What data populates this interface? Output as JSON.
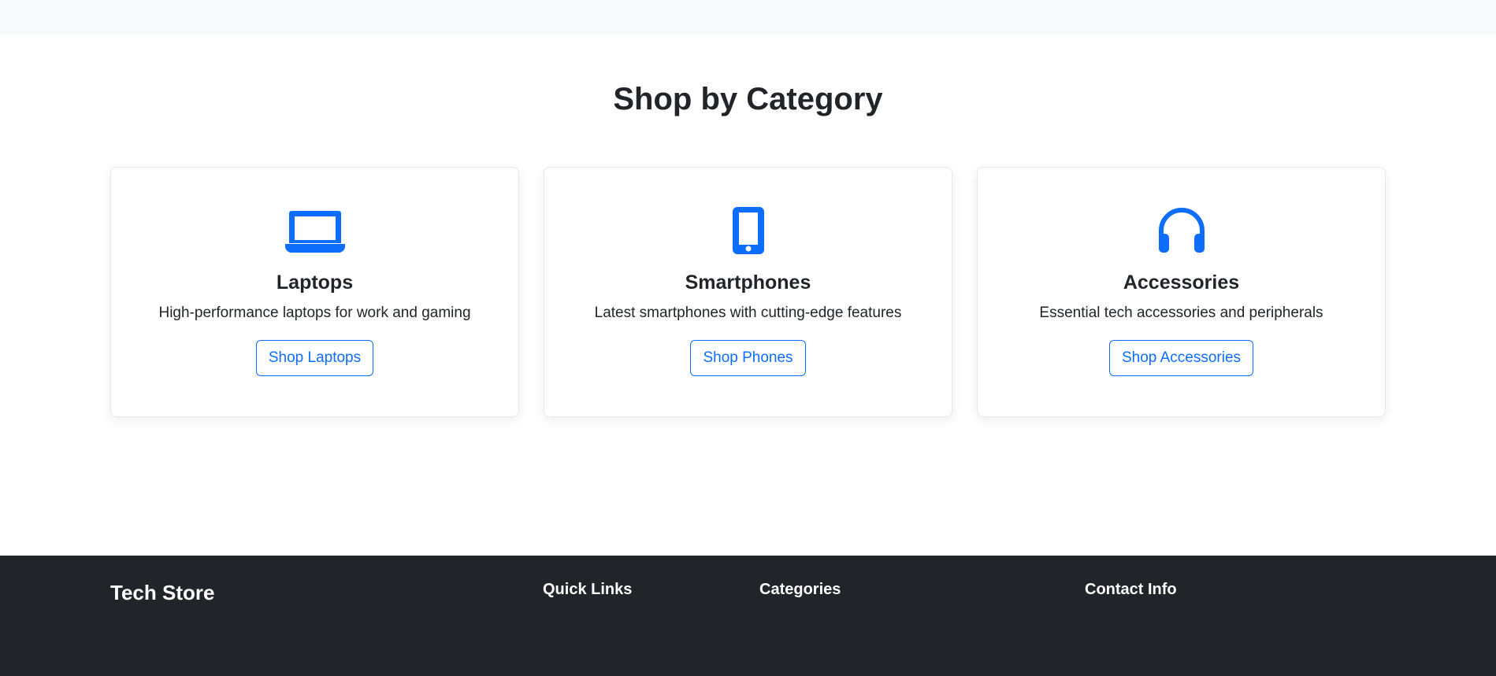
{
  "section": {
    "title": "Shop by Category"
  },
  "colors": {
    "accent": "#0d6efd",
    "footer_bg": "#212529",
    "top_band": "#f8f9fa"
  },
  "categories": [
    {
      "icon": "laptop-icon",
      "name": "Laptops",
      "description": "High-performance laptops for work and gaming",
      "button": "Shop Laptops"
    },
    {
      "icon": "phone-icon",
      "name": "Smartphones",
      "description": "Latest smartphones with cutting-edge features",
      "button": "Shop Phones"
    },
    {
      "icon": "headphones-icon",
      "name": "Accessories",
      "description": "Essential tech accessories and peripherals",
      "button": "Shop Accessories"
    }
  ],
  "footer": {
    "brand": "Tech Store",
    "quick_links_heading": "Quick Links",
    "categories_heading": "Categories",
    "contact_heading": "Contact Info"
  }
}
